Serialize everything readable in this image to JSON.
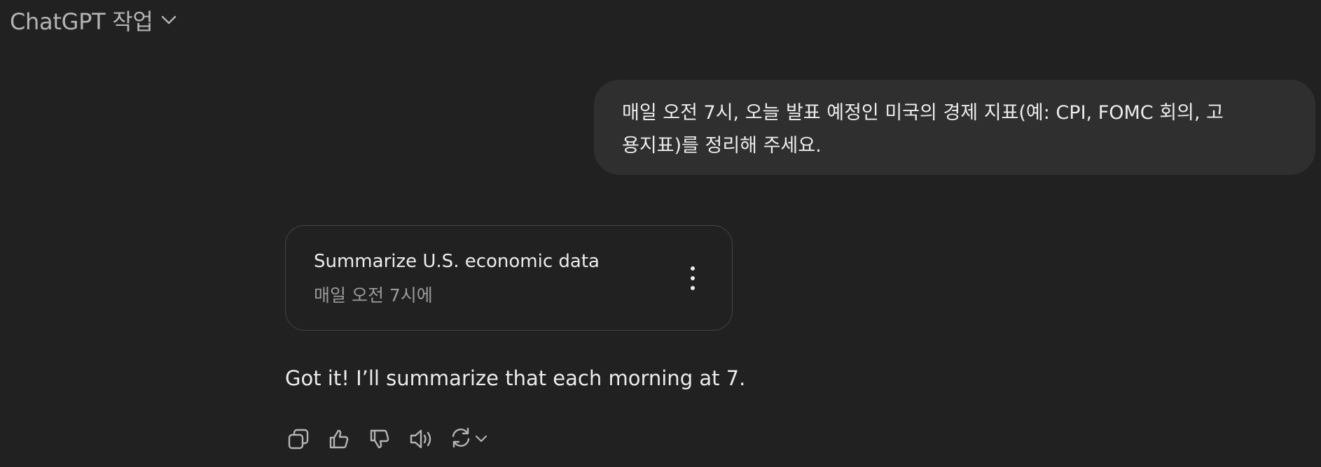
{
  "header": {
    "title": "ChatGPT 작업",
    "dropdown_icon": "chevron-down-icon"
  },
  "user_message": {
    "line1": "매일 오전 7시, 오늘 발표 예정인 미국의 경제 지표(예: CPI, FOMC 회의, 고",
    "line2": "용지표)를 정리해 주세요."
  },
  "task_card": {
    "title": "Summarize U.S. economic data",
    "schedule": "매일 오전 7시에",
    "menu_icon": "more-vertical-icon"
  },
  "assistant_message": {
    "text": "Got it! I’ll summarize that each morning at 7."
  },
  "actions": {
    "icons": [
      "copy-icon",
      "thumbs-up-icon",
      "thumbs-down-icon",
      "speaker-icon",
      "regenerate-icon",
      "chevron-down-icon"
    ]
  },
  "colors": {
    "background": "#212121",
    "bubble": "#2f2f2f",
    "text": "#ececec",
    "muted": "#9b9b9b",
    "border": "#444444"
  }
}
